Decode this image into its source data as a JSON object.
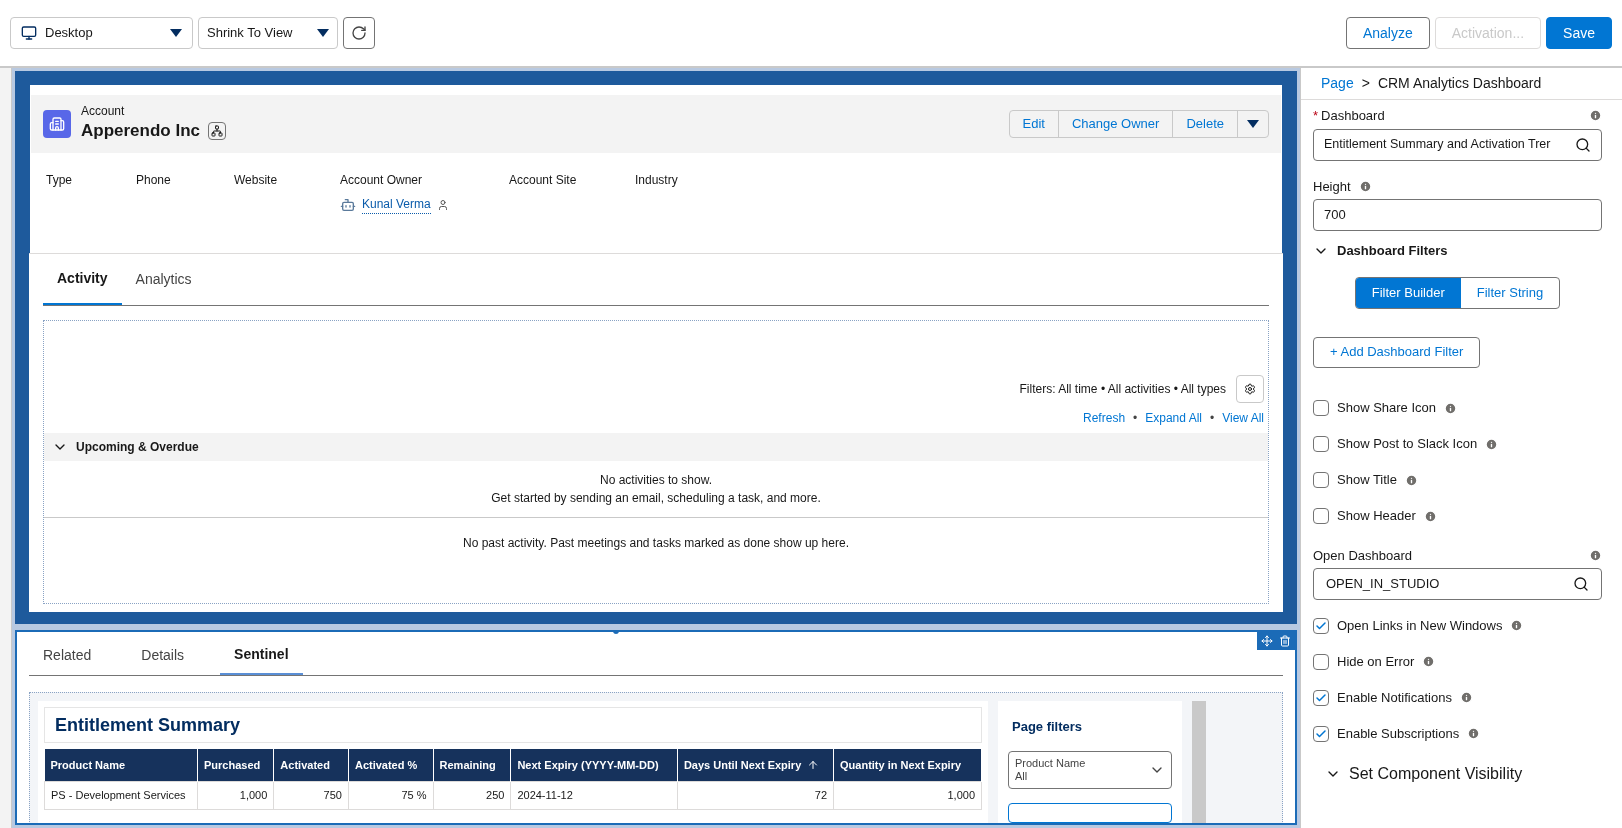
{
  "toolbar": {
    "device_select": "Desktop",
    "zoom_select": "Shrink To View",
    "buttons": [
      {
        "label": "Analyze",
        "kind": "outline",
        "disabled": false
      },
      {
        "label": "Activation...",
        "kind": "outline",
        "disabled": true
      },
      {
        "label": "Save",
        "kind": "primary",
        "disabled": false
      }
    ]
  },
  "record": {
    "object_label": "Account",
    "name": "Apperendo Inc",
    "actions": [
      "Edit",
      "Change Owner",
      "Delete"
    ],
    "fields": [
      {
        "label": "Type"
      },
      {
        "label": "Phone"
      },
      {
        "label": "Website"
      },
      {
        "label": "Account Owner",
        "value": "Kunal Verma"
      },
      {
        "label": "Account Site"
      },
      {
        "label": "Industry"
      }
    ]
  },
  "activity": {
    "tabs": [
      {
        "label": "Activity",
        "selected": true
      },
      {
        "label": "Analytics",
        "selected": false
      }
    ],
    "filters": "Filters: All time • All activities • All types",
    "links": [
      "Refresh",
      "Expand All",
      "View All"
    ],
    "link_separator": "•",
    "section": {
      "title": "Upcoming & Overdue",
      "expanded": true,
      "messages": [
        "No activities to show.",
        "Get started by sending an email, scheduling a task, and more."
      ]
    },
    "past_message": "No past activity. Past meetings and tasks marked as done show up here."
  },
  "lower_tabs": [
    {
      "label": "Related",
      "selected": false
    },
    {
      "label": "Details",
      "selected": false
    },
    {
      "label": "Sentinel",
      "selected": true
    }
  ],
  "dashboard": {
    "title": "Entitlement Summary",
    "columns": [
      {
        "label": "Product Name",
        "kind": "text",
        "sorted": false
      },
      {
        "label": "Purchased",
        "kind": "number",
        "sorted": false
      },
      {
        "label": "Activated",
        "kind": "number",
        "sorted": false
      },
      {
        "label": "Activated %",
        "kind": "number",
        "sorted": false
      },
      {
        "label": "Remaining",
        "kind": "number",
        "sorted": false
      },
      {
        "label": "Next Expiry (YYYY-MM-DD)",
        "kind": "text",
        "sorted": false
      },
      {
        "label": "Days Until Next Expiry",
        "kind": "number",
        "sorted": true
      },
      {
        "label": "Quantity in Next Expiry",
        "kind": "number",
        "sorted": false
      }
    ],
    "rows": [
      [
        "PS - Development Services",
        "1,000",
        "750",
        "75 %",
        "250",
        "2024-11-12",
        "72",
        "1,000"
      ]
    ],
    "page_filters": {
      "title": "Page filters",
      "filters": [
        {
          "label": "Product Name",
          "value": "All"
        }
      ]
    }
  },
  "panel": {
    "breadcrumb": [
      "Page",
      "CRM Analytics Dashboard"
    ],
    "breadcrumb_separator": ">",
    "dashboard_field": {
      "label": "Dashboard",
      "required_marker": "*",
      "value": "Entitlement Summary and Activation Trer"
    },
    "height_field": {
      "label": "Height",
      "value": "700"
    },
    "filters_section": {
      "title": "Dashboard Filters",
      "expanded": true
    },
    "segments": [
      {
        "label": "Filter Builder",
        "selected": true
      },
      {
        "label": "Filter String",
        "selected": false
      }
    ],
    "add_button": "+ Add Dashboard Filter",
    "settings": [
      {
        "kind": "checkbox",
        "label": "Show Share Icon",
        "checked": false
      },
      {
        "kind": "checkbox",
        "label": "Show Post to Slack Icon",
        "checked": false
      },
      {
        "kind": "checkbox",
        "label": "Show Title",
        "checked": false
      },
      {
        "kind": "checkbox",
        "label": "Show Header",
        "checked": false
      },
      {
        "kind": "lookup",
        "label": "Open Dashboard",
        "value": "OPEN_IN_STUDIO"
      },
      {
        "kind": "checkbox",
        "label": "Open Links in New Windows",
        "checked": true
      },
      {
        "kind": "checkbox",
        "label": "Hide on Error",
        "checked": false
      },
      {
        "kind": "checkbox",
        "label": "Enable Notifications",
        "checked": true
      },
      {
        "kind": "checkbox",
        "label": "Enable Subscriptions",
        "checked": true
      }
    ],
    "visibility_section": {
      "title": "Set Component Visibility",
      "expanded": true
    }
  }
}
